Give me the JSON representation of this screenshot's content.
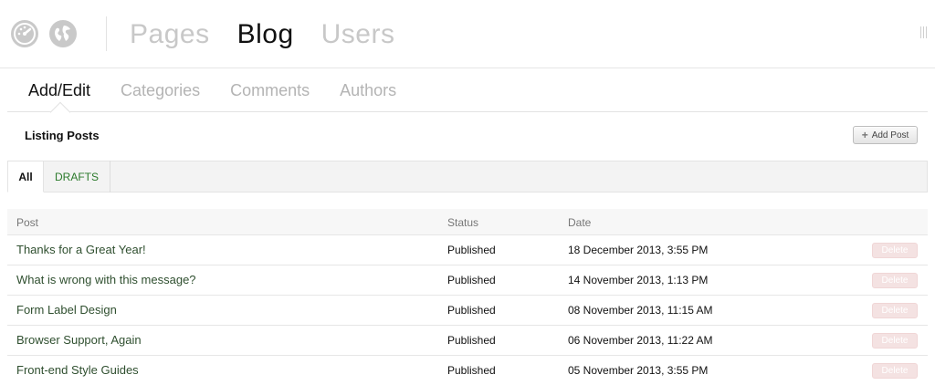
{
  "topbar": {
    "icons": [
      "dashboard-icon",
      "globe-icon"
    ],
    "nav": [
      {
        "label": "Pages",
        "active": false
      },
      {
        "label": "Blog",
        "active": true
      },
      {
        "label": "Users",
        "active": false
      }
    ]
  },
  "subnav": {
    "tabs": [
      {
        "label": "Add/Edit",
        "active": true
      },
      {
        "label": "Categories",
        "active": false
      },
      {
        "label": "Comments",
        "active": false
      },
      {
        "label": "Authors",
        "active": false
      }
    ]
  },
  "listing": {
    "title": "Listing Posts",
    "add_button": "Add Post"
  },
  "filters": {
    "all": "All",
    "drafts": "DRAFTS"
  },
  "table": {
    "headers": {
      "post": "Post",
      "status": "Status",
      "date": "Date"
    },
    "delete_label": "Delete",
    "rows": [
      {
        "post": "Thanks for a Great Year!",
        "status": "Published",
        "date": "18 December 2013, 3:55 PM"
      },
      {
        "post": "What is wrong with this message?",
        "status": "Published",
        "date": "14 November 2013, 1:13 PM"
      },
      {
        "post": "Form Label Design",
        "status": "Published",
        "date": "08 November 2013, 11:15 AM"
      },
      {
        "post": "Browser Support, Again",
        "status": "Published",
        "date": "06 November 2013, 11:22 AM"
      },
      {
        "post": "Front-end Style Guides",
        "status": "Published",
        "date": "05 November 2013, 3:55 PM"
      }
    ]
  },
  "colors": {
    "accent_green": "#2b7a2b",
    "delete_bg": "#f4e2e2",
    "inactive_nav": "#c8c8c8"
  }
}
